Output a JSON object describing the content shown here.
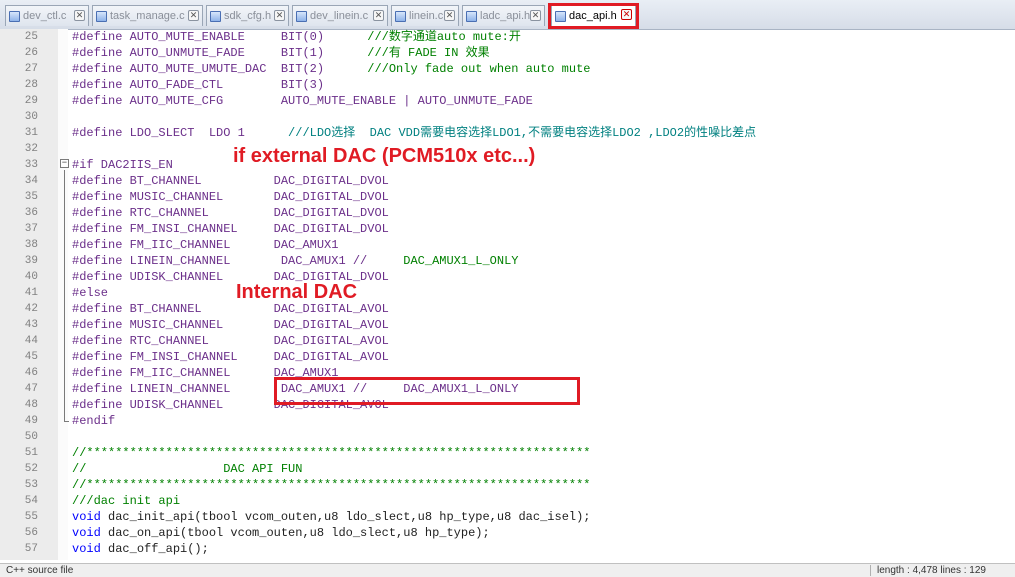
{
  "tabs": [
    {
      "label": "dev_ctl.c",
      "active": false
    },
    {
      "label": "task_manage.c",
      "active": false
    },
    {
      "label": "sdk_cfg.h",
      "active": false
    },
    {
      "label": "dev_linein.c",
      "active": false
    },
    {
      "label": "linein.c",
      "active": false
    },
    {
      "label": "ladc_api.h",
      "active": false
    },
    {
      "label": "dac_api.h",
      "active": true
    }
  ],
  "close_glyph": "✕",
  "lines": [
    {
      "n": "25",
      "parts": [
        [
          "pp",
          "#define AUTO_MUTE_ENABLE     BIT(0)      "
        ],
        [
          "cm",
          "///数字通道auto mute:开"
        ]
      ]
    },
    {
      "n": "26",
      "parts": [
        [
          "pp",
          "#define AUTO_UNMUTE_FADE     BIT(1)      "
        ],
        [
          "cm",
          "///有 FADE IN 效果"
        ]
      ]
    },
    {
      "n": "27",
      "parts": [
        [
          "pp",
          "#define AUTO_MUTE_UMUTE_DAC  BIT(2)      "
        ],
        [
          "cm",
          "///Only fade out when auto mute"
        ]
      ]
    },
    {
      "n": "28",
      "parts": [
        [
          "pp",
          "#define AUTO_FADE_CTL        BIT(3)"
        ]
      ]
    },
    {
      "n": "29",
      "parts": [
        [
          "pp",
          "#define AUTO_MUTE_CFG        AUTO_MUTE_ENABLE | AUTO_UNMUTE_FADE"
        ]
      ]
    },
    {
      "n": "30",
      "parts": []
    },
    {
      "n": "31",
      "parts": [
        [
          "pp",
          "#define LDO_SLECT  LDO 1      "
        ],
        [
          "cm2",
          "///LDO选择  DAC VDD需要电容选择LDO1,不需要电容选择LDO2 ,LDO2的性噪比差点"
        ]
      ]
    },
    {
      "n": "32",
      "parts": []
    },
    {
      "n": "33",
      "parts": [
        [
          "pp",
          "#if DAC2IIS_EN"
        ]
      ]
    },
    {
      "n": "34",
      "parts": [
        [
          "pp",
          "#define BT_CHANNEL          DAC_DIGITAL_DVOL"
        ]
      ]
    },
    {
      "n": "35",
      "parts": [
        [
          "pp",
          "#define MUSIC_CHANNEL       DAC_DIGITAL_DVOL"
        ]
      ]
    },
    {
      "n": "36",
      "parts": [
        [
          "pp",
          "#define RTC_CHANNEL         DAC_DIGITAL_DVOL"
        ]
      ]
    },
    {
      "n": "37",
      "parts": [
        [
          "pp",
          "#define FM_INSI_CHANNEL     DAC_DIGITAL_DVOL"
        ]
      ]
    },
    {
      "n": "38",
      "parts": [
        [
          "pp",
          "#define FM_IIC_CHANNEL      DAC_AMUX1"
        ]
      ]
    },
    {
      "n": "39",
      "parts": [
        [
          "pp",
          "#define LINEIN_CHANNEL       DAC_AMUX1 //     "
        ],
        [
          "cm",
          "DAC_AMUX1_L_ONLY"
        ]
      ]
    },
    {
      "n": "40",
      "parts": [
        [
          "pp",
          "#define UDISK_CHANNEL       DAC_DIGITAL_DVOL"
        ]
      ]
    },
    {
      "n": "41",
      "parts": [
        [
          "pp",
          "#else"
        ]
      ]
    },
    {
      "n": "42",
      "parts": [
        [
          "pp",
          "#define BT_CHANNEL          DAC_DIGITAL_AVOL"
        ]
      ]
    },
    {
      "n": "43",
      "parts": [
        [
          "pp",
          "#define MUSIC_CHANNEL       DAC_DIGITAL_AVOL"
        ]
      ]
    },
    {
      "n": "44",
      "parts": [
        [
          "pp",
          "#define RTC_CHANNEL         DAC_DIGITAL_AVOL"
        ]
      ]
    },
    {
      "n": "45",
      "parts": [
        [
          "pp",
          "#define FM_INSI_CHANNEL     DAC_DIGITAL_AVOL"
        ]
      ]
    },
    {
      "n": "46",
      "parts": [
        [
          "pp",
          "#define FM_IIC_CHANNEL      DAC_AMUX1"
        ]
      ]
    },
    {
      "n": "47",
      "parts": [
        [
          "pp",
          "#define LINEIN_CHANNEL       DAC_AMUX1 //     DAC_AMUX1_L_ONLY"
        ]
      ]
    },
    {
      "n": "48",
      "parts": [
        [
          "pp",
          "#define UDISK_CHANNEL       DAC_DIGITAL_AVOL"
        ]
      ]
    },
    {
      "n": "49",
      "parts": [
        [
          "pp",
          "#endif"
        ]
      ]
    },
    {
      "n": "50",
      "parts": []
    },
    {
      "n": "51",
      "parts": [
        [
          "cm",
          "//**********************************************************************"
        ]
      ]
    },
    {
      "n": "52",
      "parts": [
        [
          "cm",
          "//                   DAC API FUN"
        ]
      ]
    },
    {
      "n": "53",
      "parts": [
        [
          "cm",
          "//**********************************************************************"
        ]
      ]
    },
    {
      "n": "54",
      "parts": [
        [
          "cm",
          "///dac init api"
        ]
      ]
    },
    {
      "n": "55",
      "parts": [
        [
          "kw",
          "void"
        ],
        [
          "tx",
          " dac_init_api(tbool vcom_outen,u8 ldo_slect,u8 hp_type,u8 dac_isel);"
        ]
      ]
    },
    {
      "n": "56",
      "parts": [
        [
          "kw",
          "void"
        ],
        [
          "tx",
          " dac_on_api(tbool vcom_outen,u8 ldo_slect,u8 hp_type);"
        ]
      ]
    },
    {
      "n": "57",
      "parts": [
        [
          "kw",
          "void"
        ],
        [
          "tx",
          " dac_off_api();"
        ]
      ]
    }
  ],
  "annotations": {
    "external": "if external DAC (PCM510x etc...)",
    "internal": "Internal DAC"
  },
  "status": {
    "left": "C++ source file",
    "right": "length : 4,478    lines : 129"
  },
  "colors": {
    "annotation": "#e01b24",
    "keyword": "#0000ff",
    "comment": "#008000"
  }
}
